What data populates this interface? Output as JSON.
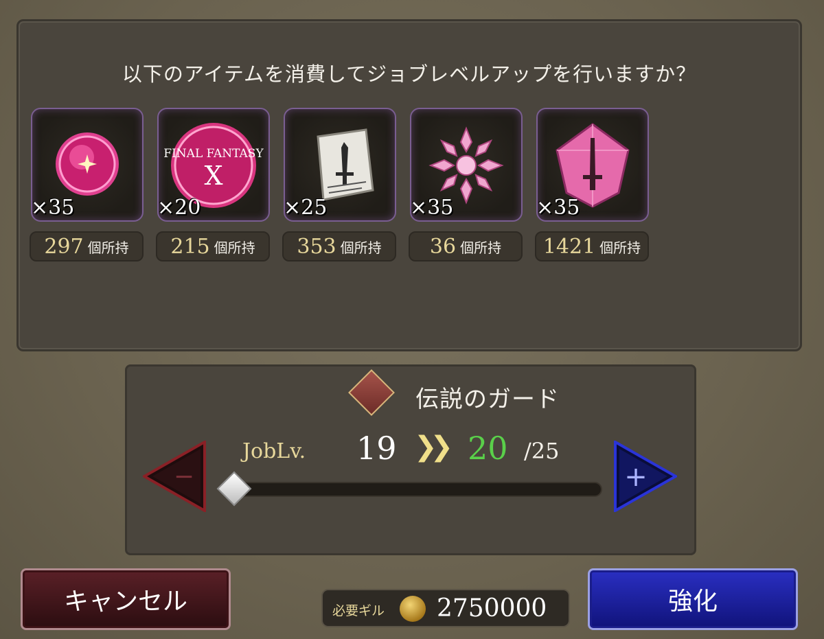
{
  "dialog": {
    "prompt": "以下のアイテムを消費してジョブレベルアップを行いますか？"
  },
  "items": [
    {
      "icon": "pink-orb-icon",
      "cost": "×35",
      "owned": "297",
      "owned_unit": "個所持"
    },
    {
      "icon": "ffx-crystal-icon",
      "cost": "×20",
      "owned": "215",
      "owned_unit": "個所持",
      "icon_text_1": "FINAL FANTASY",
      "icon_text_2": "X"
    },
    {
      "icon": "sword-tablet-icon",
      "cost": "×25",
      "owned": "353",
      "owned_unit": "個所持"
    },
    {
      "icon": "snowflake-crystal-icon",
      "cost": "×35",
      "owned": "36",
      "owned_unit": "個所持"
    },
    {
      "icon": "sword-gem-icon",
      "cost": "×35",
      "owned": "1421",
      "owned_unit": "個所持"
    }
  ],
  "job": {
    "name": "伝説のガード",
    "level_label": "JobLv.",
    "current_level": "19",
    "next_level": "20",
    "max_level": "/25",
    "level_arrow": "❯❯",
    "slider_fraction": 0.0
  },
  "controls": {
    "minus_label": "−",
    "plus_label": "+",
    "cancel_label": "キャンセル",
    "enhance_label": "強化",
    "gil_label": "必要ギル",
    "gil_value": "2750000"
  },
  "colors": {
    "owned_number": "#e7d79b",
    "next_level": "#5ad04a",
    "cancel_button": "#5a2027",
    "enhance_button": "#2a2fc2"
  }
}
